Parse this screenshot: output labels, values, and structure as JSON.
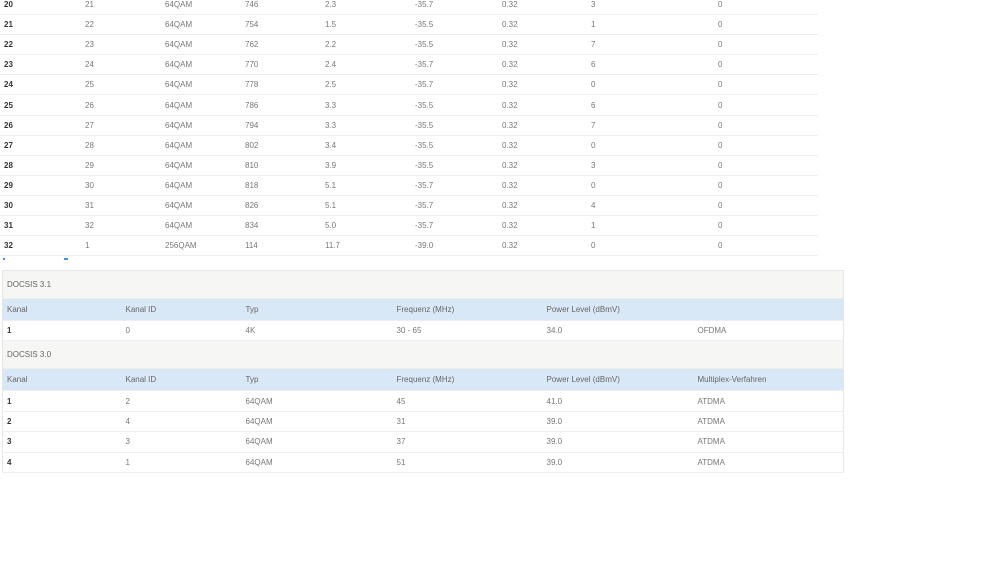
{
  "downstream_rows": [
    [
      "20",
      "21",
      "64QAM",
      "746",
      "2.3",
      "-35.7",
      "0.32",
      "3",
      "0"
    ],
    [
      "21",
      "22",
      "64QAM",
      "754",
      "1.5",
      "-35.5",
      "0.32",
      "1",
      "0"
    ],
    [
      "22",
      "23",
      "64QAM",
      "762",
      "2.2",
      "-35.5",
      "0.32",
      "7",
      "0"
    ],
    [
      "23",
      "24",
      "64QAM",
      "770",
      "2.4",
      "-35.7",
      "0.32",
      "6",
      "0"
    ],
    [
      "24",
      "25",
      "64QAM",
      "778",
      "2.5",
      "-35.7",
      "0.32",
      "0",
      "0"
    ],
    [
      "25",
      "26",
      "64QAM",
      "786",
      "3.3",
      "-35.5",
      "0.32",
      "6",
      "0"
    ],
    [
      "26",
      "27",
      "64QAM",
      "794",
      "3.3",
      "-35.5",
      "0.32",
      "7",
      "0"
    ],
    [
      "27",
      "28",
      "64QAM",
      "802",
      "3.4",
      "-35.5",
      "0.32",
      "0",
      "0"
    ],
    [
      "28",
      "29",
      "64QAM",
      "810",
      "3.9",
      "-35.5",
      "0.32",
      "3",
      "0"
    ],
    [
      "29",
      "30",
      "64QAM",
      "818",
      "5.1",
      "-35.7",
      "0.32",
      "0",
      "0"
    ],
    [
      "30",
      "31",
      "64QAM",
      "826",
      "5.1",
      "-35.7",
      "0.32",
      "4",
      "0"
    ],
    [
      "31",
      "32",
      "64QAM",
      "834",
      "5.0",
      "-35.7",
      "0.32",
      "1",
      "0"
    ],
    [
      "32",
      "1",
      "256QAM",
      "114",
      "11.7",
      "-39.0",
      "0.32",
      "0",
      "0"
    ]
  ],
  "upstream": {
    "docsis31": {
      "title": "DOCSIS 3.1",
      "headers": [
        "Kanal",
        "Kanal ID",
        "Typ",
        "Frequenz (MHz)",
        "Power Level (dBmV)",
        ""
      ],
      "rows": [
        [
          "1",
          "0",
          "4K",
          "30 - 65",
          "34.0",
          "OFDMA"
        ]
      ]
    },
    "docsis30": {
      "title": "DOCSIS 3.0",
      "headers": [
        "Kanal",
        "Kanal ID",
        "Typ",
        "Frequenz (MHz)",
        "Power Level (dBmV)",
        "Multiplex-Verfahren"
      ],
      "rows": [
        [
          "1",
          "2",
          "64QAM",
          "45",
          "41.0",
          "ATDMA"
        ],
        [
          "2",
          "4",
          "64QAM",
          "31",
          "39.0",
          "ATDMA"
        ],
        [
          "3",
          "3",
          "64QAM",
          "37",
          "39.0",
          "ATDMA"
        ],
        [
          "4",
          "1",
          "64QAM",
          "51",
          "39.0",
          "ATDMA"
        ]
      ]
    }
  }
}
